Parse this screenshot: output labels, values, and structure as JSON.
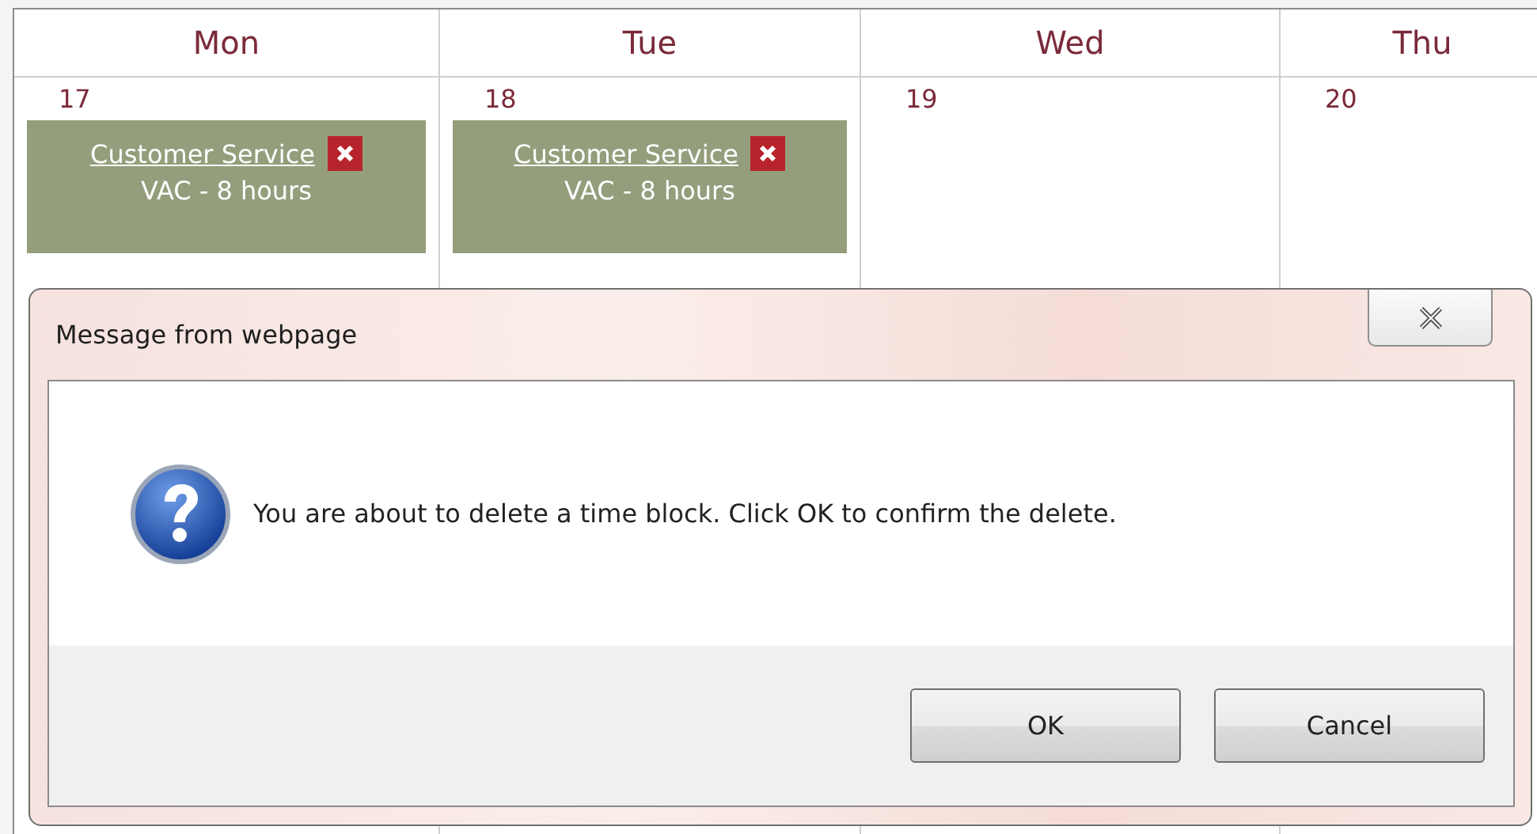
{
  "calendar": {
    "days": [
      {
        "name": "Mon",
        "date": "17",
        "events": [
          {
            "title": "Customer Service",
            "detail": "VAC - 8 hours"
          }
        ]
      },
      {
        "name": "Tue",
        "date": "18",
        "events": [
          {
            "title": "Customer Service",
            "detail": "VAC - 8 hours"
          }
        ]
      },
      {
        "name": "Wed",
        "date": "19"
      },
      {
        "name": "Thu",
        "date": "20"
      }
    ]
  },
  "dialog": {
    "title": "Message from webpage",
    "message": "You are about to delete a time block. Click OK to confirm the delete.",
    "buttons": [
      "OK",
      "Cancel"
    ]
  }
}
